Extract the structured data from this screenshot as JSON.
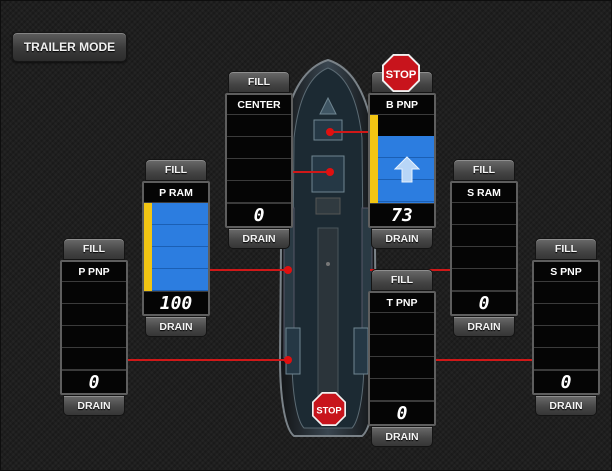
{
  "trailer_mode": {
    "label": "TRAILER MODE"
  },
  "stop_label": "STOP",
  "tanks": {
    "center": {
      "fill": "FILL",
      "name": "CENTER",
      "value": "0",
      "drain": "DRAIN",
      "level": 0
    },
    "b_pnp": {
      "fill": "FILL",
      "name": "B PNP",
      "value": "73",
      "drain": "DRAIN",
      "level": 0.73
    },
    "p_ram": {
      "fill": "FILL",
      "name": "P RAM",
      "value": "100",
      "drain": "DRAIN",
      "level": 1.0
    },
    "s_ram": {
      "fill": "FILL",
      "name": "S RAM",
      "value": "0",
      "drain": "DRAIN",
      "level": 0
    },
    "p_pnp": {
      "fill": "FILL",
      "name": "P PNP",
      "value": "0",
      "drain": "DRAIN",
      "level": 0
    },
    "t_pnp": {
      "fill": "FILL",
      "name": "T PNP",
      "value": "0",
      "drain": "DRAIN",
      "level": 0
    },
    "s_pnp": {
      "fill": "FILL",
      "name": "S PNP",
      "value": "0",
      "drain": "DRAIN",
      "level": 0
    }
  },
  "colors": {
    "fill_blue": "#2c7de0",
    "level_yellow": "#f2c513",
    "line_red": "#d01818",
    "stop_red": "#c8141c"
  }
}
